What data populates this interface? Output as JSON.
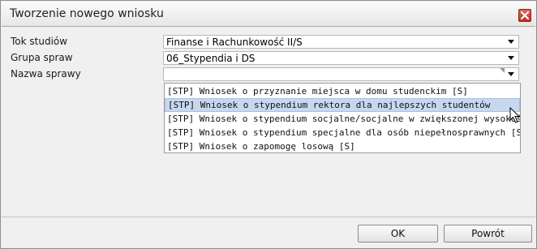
{
  "window": {
    "title": "Tworzenie nowego wniosku"
  },
  "form": {
    "tok_studiow": {
      "label": "Tok studiów",
      "value": "Finanse i Rachunkowość II/S"
    },
    "grupa_spraw": {
      "label": "Grupa spraw",
      "value": "06_Stypendia i DS"
    },
    "nazwa_sprawy": {
      "label": "Nazwa sprawy",
      "value": ""
    }
  },
  "dropdown": {
    "items": [
      {
        "label": "[STP] Wniosek o przyznanie miejsca w domu studenckim [S]",
        "selected": false
      },
      {
        "label": "[STP] Wniosek o stypendium rektora dla najlepszych studentów",
        "selected": true
      },
      {
        "label": "[STP] Wniosek o stypendium socjalne/socjalne w zwiększonej wysokości[",
        "selected": false
      },
      {
        "label": "[STP] Wniosek o stypendium specjalne dla osób niepełnosprawnych [S]",
        "selected": false
      },
      {
        "label": "[STP] Wniosek o zapomogę losową [S]",
        "selected": false
      }
    ]
  },
  "buttons": {
    "ok_label": "OK",
    "back_label": "Powrót"
  },
  "icons": {
    "close": "close-icon",
    "dropdown_arrow": "chevron-down-icon",
    "cursor": "mouse-pointer-icon"
  },
  "colors": {
    "selected_bg": "#c7d7ee",
    "close_red": "#c9442f",
    "dialog_bg": "#f0f0f0"
  }
}
